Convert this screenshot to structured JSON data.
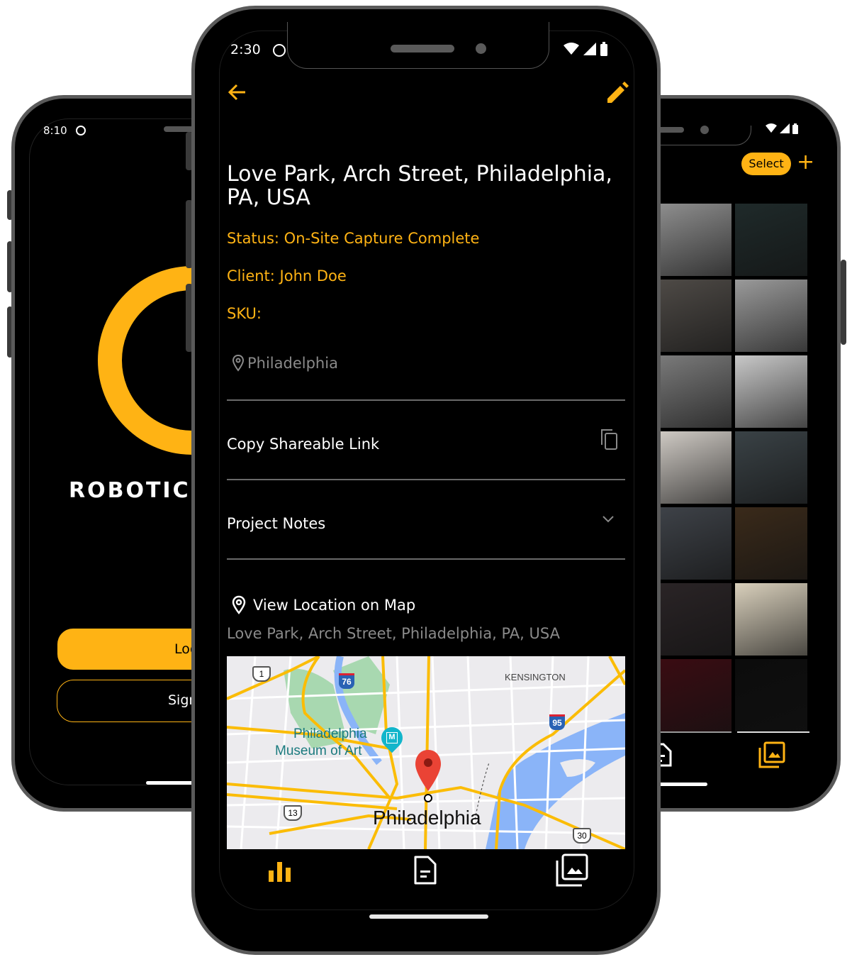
{
  "colors": {
    "accent": "#ffb314",
    "background": "#000000",
    "muted_text": "#8a8a8a",
    "frame": "#5a5a5a"
  },
  "left_phone": {
    "status_time": "8:10",
    "status_icons": [
      "notification-face-icon"
    ],
    "logo_shape": "ring",
    "brand_text": "ROBOTIC",
    "login_button": "Log",
    "signup_button": "Sign"
  },
  "center_phone": {
    "status_time": "2:30",
    "status_icons": [
      "notification-face-icon",
      "wifi-icon",
      "signal-icon",
      "battery-icon"
    ],
    "toolbar": {
      "back_icon": "arrow-left-icon",
      "edit_icon": "pencil-icon"
    },
    "project": {
      "title": "Love Park, Arch Street, Philadelphia, PA, USA",
      "status": "Status: On-Site Capture Complete",
      "client": "Client: John Doe",
      "sku": "SKU:",
      "city": "Philadelphia"
    },
    "actions": {
      "copy_link": "Copy Shareable Link",
      "project_notes": "Project Notes",
      "view_map": "View Location on Map",
      "address": "Love Park, Arch Street, Philadelphia, PA, USA"
    },
    "map": {
      "labels": {
        "neighborhood": "KENSINGTON",
        "poi_line1": "Philadelphia",
        "poi_line2": "Museum of Art",
        "city": "Philadelphia"
      },
      "shields": {
        "us1": "1",
        "i76": "76",
        "i95": "95",
        "us13": "13",
        "us30": "30"
      },
      "poi_icon_letter": "M"
    },
    "bottom_nav": [
      {
        "icon": "bar-chart-icon",
        "active": true
      },
      {
        "icon": "document-icon",
        "active": false
      },
      {
        "icon": "photo-library-icon",
        "active": false
      }
    ]
  },
  "right_phone": {
    "status_icons": [
      "wifi-icon",
      "signal-icon",
      "battery-icon"
    ],
    "select_button": "Select",
    "add_button": "+",
    "photos": [
      {
        "desc": "grey building atrium",
        "color": "#8e8e8e"
      },
      {
        "desc": "night doorway light",
        "color": "#1f2a2a"
      },
      {
        "desc": "interior shelf",
        "color": "#4e4a46"
      },
      {
        "desc": "skyscraper grey",
        "color": "#9a9a9a"
      },
      {
        "desc": "building facade",
        "color": "#7a7a7a"
      },
      {
        "desc": "white building windows",
        "color": "#c8c8c8"
      },
      {
        "desc": "plants and books",
        "color": "#cfcac4"
      },
      {
        "desc": "looking up buildings",
        "color": "#3a4246"
      },
      {
        "desc": "escalator lights",
        "color": "#3e4248"
      },
      {
        "desc": "neon sign orange",
        "color": "#3a2a1a"
      },
      {
        "desc": "alley pink sky",
        "color": "#2a2426"
      },
      {
        "desc": "lamp post shadow",
        "color": "#d9d0bc"
      },
      {
        "desc": "red neon roof",
        "color": "#3a0c12"
      },
      {
        "desc": "dark symmetric",
        "color": "#0c0c0c"
      }
    ],
    "bottom_nav": [
      {
        "icon": "document-icon",
        "active": false
      },
      {
        "icon": "photo-library-icon",
        "active": true
      }
    ]
  }
}
